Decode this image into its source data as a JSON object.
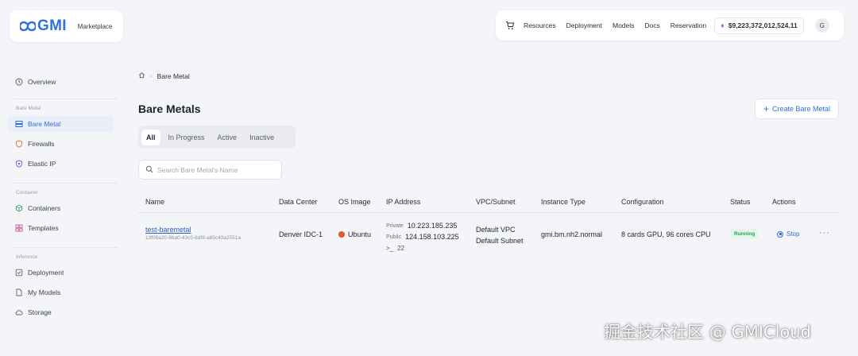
{
  "brand": {
    "name": "GMI",
    "section": "Marketplace",
    "color": "#2f6fde"
  },
  "topnav": {
    "cart_icon": "cart-icon",
    "links": [
      "Resources",
      "Deployment",
      "Models",
      "Docs",
      "Reservation"
    ],
    "balance": "$9,223,372,012,524.11",
    "avatar": "G"
  },
  "sidebar": {
    "overview": "Overview",
    "section_bare_metal": "Bare Metal",
    "bare_metal": "Bare Metal",
    "firewalls": "Firewalls",
    "elastic_ip": "Elastic IP",
    "section_container": "Container",
    "containers": "Containers",
    "templates": "Templates",
    "section_inference": "Inference",
    "deployment": "Deployment",
    "my_models": "My Models",
    "storage": "Storage"
  },
  "breadcrumb": {
    "current": "Bare Metal"
  },
  "page": {
    "title": "Bare Metals",
    "create_label": "Create Bare Metal",
    "tabs": [
      "All",
      "In Progress",
      "Active",
      "Inactive"
    ],
    "active_tab": "All",
    "search_placeholder": "Search Bare Metal's Name"
  },
  "table": {
    "headers": [
      "Name",
      "Data Center",
      "OS Image",
      "IP Address",
      "VPC/Subnet",
      "Instance Type",
      "Configuration",
      "Status",
      "Actions"
    ],
    "rows": [
      {
        "name": "test-baremetal",
        "id": "13f09a20-6ba0-43c0-8df8-a85c40a2551a",
        "data_center": "Denver IDC-1",
        "os_image": "Ubuntu",
        "private_label": "Private",
        "private_ip": "10.223.185.235",
        "public_label": "Public",
        "public_ip": "124.158.103.225",
        "ssh_port": "22",
        "vpc": "Default VPC",
        "subnet": "Default Subnet",
        "instance_type": "gmi.bm.nh2.normal",
        "configuration": "8 cards GPU, 96 cores CPU",
        "status": "Running",
        "action": "Stop",
        "more": "···"
      }
    ]
  },
  "watermark": "掘金技术社区 @ GMICloud"
}
